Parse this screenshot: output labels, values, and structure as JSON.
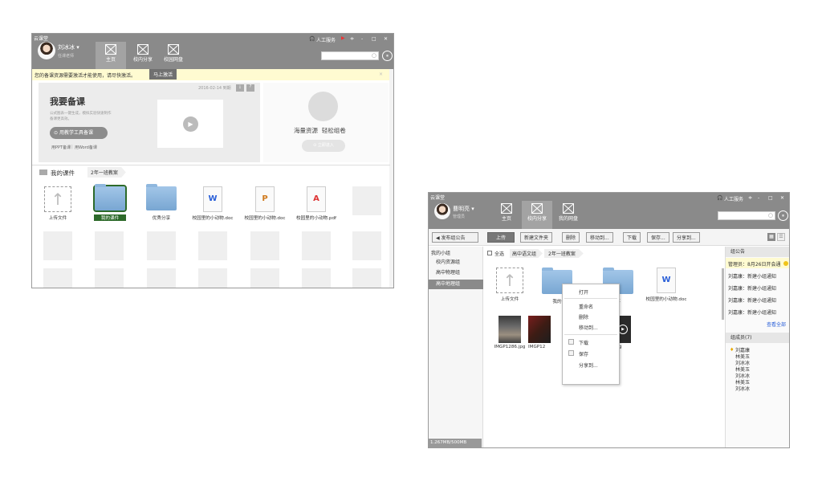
{
  "win1": {
    "app_title": "云课堂",
    "user": {
      "name": "刘冰冰 ▾",
      "role": "任课老师"
    },
    "nav": [
      "主页",
      "校内分享",
      "校园网盘"
    ],
    "controls": {
      "service": "人工服务",
      "minimize": "-",
      "maximize": "□",
      "close": "✕"
    },
    "search_placeholder": "",
    "notice": {
      "text": "您的备课资源需要激活才能使用，请尽快激活。",
      "button": "马上激活",
      "close": "×"
    },
    "prep": {
      "title": "我要备课",
      "desc1": "公式图表一键生成，模拟实验快速制作",
      "desc2": "备课更高效。",
      "btn": "用教学工具备课",
      "links": [
        "用PPT备课",
        "用Word备课"
      ],
      "date": "2016-02-14 到期",
      "right_text": "海量资源  轻松组卷",
      "right_btn": "立即进入"
    },
    "courseware": {
      "title": "我的课件",
      "crumb": "2年一班教案",
      "files": [
        "上传文件",
        "我的课件",
        "优秀分享",
        "校园里的小动物.doc",
        "校园里的小动物.doc",
        "校园里的小动物.pdf"
      ]
    },
    "doc_letters": {
      "word": "W",
      "ppt": "P",
      "pdf": "A"
    }
  },
  "win2": {
    "app_title": "云课堂",
    "user": {
      "name": "曹明亮 ▾",
      "role": "管理员"
    },
    "nav": [
      "主页",
      "校内分享",
      "我的网盘"
    ],
    "controls": {
      "service": "人工服务",
      "minimize": "-",
      "maximize": "□",
      "close": "✕"
    },
    "publish_btn": "发布组公告",
    "toolbar": [
      "上传",
      "新建文件夹",
      "删除",
      "移动到...",
      "下载",
      "保存...",
      "分享到..."
    ],
    "sidebar": {
      "title": "我的小组",
      "items": [
        "校内资源组",
        "高中物理组",
        "高中地理组"
      ],
      "storage": "1.267MB/500MB"
    },
    "crumbs": {
      "select_all": "全选",
      "items": [
        "高中语文组",
        "2年一班教案"
      ]
    },
    "files": [
      "上传文件",
      "我的",
      "事",
      "校园里的小动物.doc"
    ],
    "photos": [
      "IMGP1286.jpg",
      "IMGP12",
      "g"
    ],
    "context_menu": [
      "打开",
      "重命名",
      "删除",
      "移动到...",
      "下载",
      "保存",
      "分享到..."
    ],
    "announcements": {
      "title": "组公告",
      "items": [
        "管理员：8月26日开会通",
        "刘嘉康：新建小组通知",
        "刘嘉康：新建小组通知",
        "刘嘉康：新建小组通知",
        "刘嘉康：新建小组通知"
      ],
      "view_all": "查看全部"
    },
    "members": {
      "title": "组成员(7)",
      "items": [
        "刘嘉康",
        "林美玉",
        "刘冰冰",
        "林美玉",
        "刘冰冰",
        "林美玉",
        "刘冰冰"
      ]
    }
  },
  "colors": {
    "titlebar": "#8a8a8a",
    "notice_bg": "#fffbd1",
    "accent_blue": "#2a5fd8",
    "selected_green": "#2d6a2a"
  }
}
